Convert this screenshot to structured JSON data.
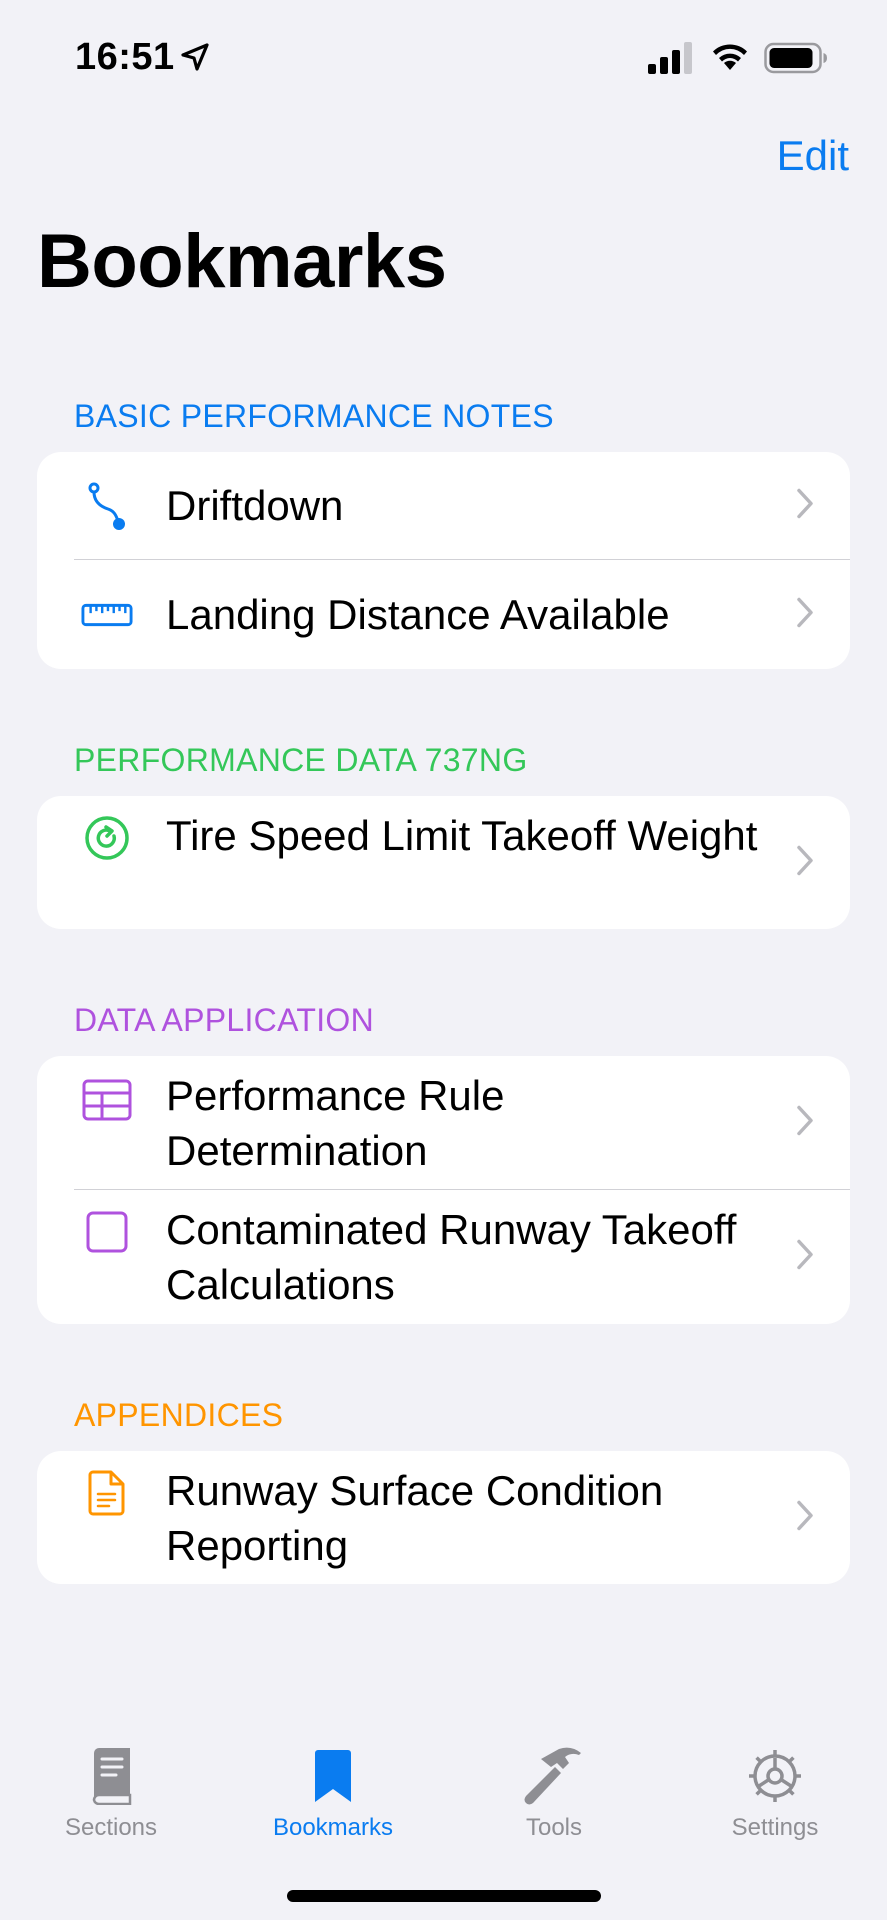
{
  "status_bar": {
    "time": "16:51"
  },
  "header": {
    "edit_label": "Edit",
    "title": "Bookmarks"
  },
  "colors": {
    "accent": "#0a7cf0",
    "basic": "#0a7cf0",
    "performance": "#34c759",
    "application": "#af52de",
    "appendices": "#ff9500"
  },
  "sections": [
    {
      "title": "BASIC PERFORMANCE NOTES",
      "items": [
        {
          "label": "Driftdown",
          "icon": "route-icon"
        },
        {
          "label": "Landing Distance Available",
          "icon": "ruler-icon"
        }
      ]
    },
    {
      "title": "PERFORMANCE DATA 737NG",
      "items": [
        {
          "label": "Tire Speed Limit Takeoff Weight",
          "icon": "circular-arrow-icon"
        }
      ]
    },
    {
      "title": "DATA APPLICATION",
      "items": [
        {
          "label": "Performance Rule Determination",
          "icon": "table-icon"
        },
        {
          "label": "Contaminated Runway Takeoff Calculations",
          "icon": "square-icon"
        }
      ]
    },
    {
      "title": "APPENDICES",
      "items": [
        {
          "label": "Runway Surface Condition Reporting",
          "icon": "document-icon"
        }
      ]
    }
  ],
  "tab_bar": {
    "tabs": [
      {
        "label": "Sections",
        "icon": "book-icon"
      },
      {
        "label": "Bookmarks",
        "icon": "bookmark-icon",
        "active": true
      },
      {
        "label": "Tools",
        "icon": "hammer-icon"
      },
      {
        "label": "Settings",
        "icon": "gear-icon"
      }
    ]
  }
}
